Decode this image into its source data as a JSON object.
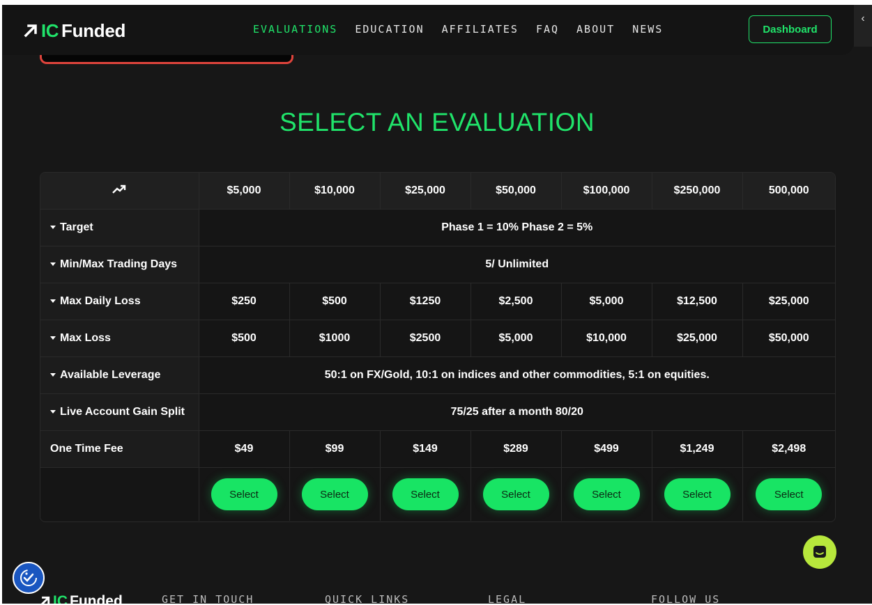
{
  "nav": {
    "logo_ic": "IC",
    "logo_funded": "Funded",
    "links": [
      {
        "label": "EVALUATIONS"
      },
      {
        "label": "EDUCATION"
      },
      {
        "label": "AFFILIATES"
      },
      {
        "label": "FAQ"
      },
      {
        "label": "ABOUT"
      },
      {
        "label": "NEWS"
      }
    ],
    "dashboard_label": "Dashboard",
    "corner_glyph": "‹"
  },
  "heading": "SELECT AN EVALUATION",
  "table": {
    "header_icon": "trend-up-icon",
    "columns": [
      "$5,000",
      "$10,000",
      "$25,000",
      "$50,000",
      "$100,000",
      "$250,000",
      "500,000"
    ],
    "rows": [
      {
        "label": "Target",
        "span": "Phase 1 = 10% Phase 2 = 5%"
      },
      {
        "label": "Min/Max Trading Days",
        "span": "5/ Unlimited"
      },
      {
        "label": "Max Daily Loss",
        "values": [
          "$250",
          "$500",
          "$1250",
          "$2,500",
          "$5,000",
          "$12,500",
          "$25,000"
        ]
      },
      {
        "label": "Max Loss",
        "values": [
          "$500",
          "$1000",
          "$2500",
          "$5,000",
          "$10,000",
          "$25,000",
          "$50,000"
        ]
      },
      {
        "label": "Available Leverage",
        "span": "50:1 on FX/Gold, 10:1 on indices and other commodities, 5:1 on equities."
      },
      {
        "label": "Live Account Gain Split",
        "span": "75/25 after a month 80/20"
      },
      {
        "label": "One Time Fee",
        "values": [
          "$49",
          "$99",
          "$149",
          "$289",
          "$499",
          "$1,249",
          "$2,498"
        ]
      }
    ],
    "select_label": "Select"
  },
  "footer": {
    "logo_ic": "IC",
    "logo_funded": "Funded",
    "columns": [
      "GET IN TOUCH",
      "QUICK LINKS",
      "LEGAL",
      "FOLLOW US"
    ]
  },
  "colors": {
    "accent": "#20e36a",
    "background": "#171717",
    "chat": "#b7e73c",
    "accessibility": "#1a56c0"
  }
}
